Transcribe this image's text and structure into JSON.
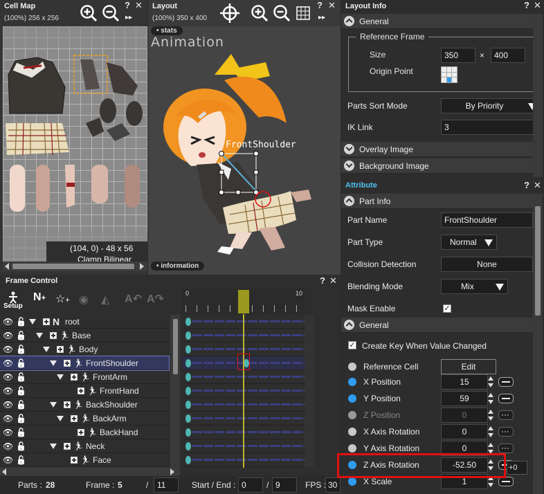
{
  "cell_map": {
    "title": "Cell Map",
    "zoom_info": "(100%) 256 x 256",
    "cell_info": "(104, 0) - 48 x 56",
    "filter_info": "Clamp  Bilinear"
  },
  "layout": {
    "title": "Layout",
    "zoom_info": "(100%) 350 x 400",
    "stats_tag": "stats",
    "animation_label": "Animation",
    "information_tag": "information",
    "part_label": "FrontShoulder"
  },
  "frame_control": {
    "title": "Frame Control",
    "setup_label": "Setup",
    "tree": [
      {
        "label": "root",
        "depth": 0,
        "kind": "root"
      },
      {
        "label": "Base",
        "depth": 1,
        "kind": "part"
      },
      {
        "label": "Body",
        "depth": 2,
        "kind": "part"
      },
      {
        "label": "FrontShoulder",
        "depth": 3,
        "kind": "part",
        "selected": true
      },
      {
        "label": "FrontArm",
        "depth": 4,
        "kind": "part"
      },
      {
        "label": "FrontHand",
        "depth": 5,
        "kind": "part"
      },
      {
        "label": "BackShoulder",
        "depth": 3,
        "kind": "part"
      },
      {
        "label": "BackArm",
        "depth": 4,
        "kind": "part"
      },
      {
        "label": "BackHand",
        "depth": 5,
        "kind": "part"
      },
      {
        "label": "Neck",
        "depth": 3,
        "kind": "part"
      },
      {
        "label": "Face",
        "depth": 4,
        "kind": "part"
      }
    ],
    "ruler_start": "0",
    "ruler_end": "10",
    "current_frame_index": 6,
    "parts_label": "Parts :",
    "parts_count": "28",
    "frame_label": "Frame :",
    "frame_value": "5",
    "frame_total": "11",
    "start_end_label": "Start / End :",
    "start_value": "0",
    "end_value": "9",
    "fps_label": "FPS :",
    "fps_value": "30"
  },
  "layout_info": {
    "title": "Layout Info",
    "general_label": "General",
    "reference_frame_label": "Reference Frame",
    "size_label": "Size",
    "size_w": "350",
    "size_x": "×",
    "size_h": "400",
    "origin_label": "Origin Point",
    "sort_mode_label": "Parts Sort Mode",
    "sort_mode_value": "By Priority",
    "ik_link_label": "IK Link",
    "ik_link_value": "3",
    "overlay_label": "Overlay Image",
    "background_label": "Background Image"
  },
  "attribute": {
    "title": "Attribute",
    "part_info_label": "Part Info",
    "part_name_label": "Part Name",
    "part_name_value": "FrontShoulder",
    "part_type_label": "Part Type",
    "part_type_value": "Normal",
    "collision_label": "Collision Detection",
    "collision_value": "None",
    "blending_label": "Blending Mode",
    "blending_value": "Mix",
    "mask_label": "Mask Enable",
    "general_label": "General",
    "create_key_label": "Create Key When Value Changed",
    "ref_cell_label": "Reference Cell",
    "edit_label": "Edit",
    "rows": [
      {
        "label": "X Position",
        "value": "15",
        "dot": "blue",
        "disabled": false
      },
      {
        "label": "Y Position",
        "value": "59",
        "dot": "blue",
        "disabled": false
      },
      {
        "label": "Z Position",
        "value": "0",
        "dot": "gray",
        "disabled": true
      },
      {
        "label": "X Axis Rotation",
        "value": "0",
        "dot": "lgray",
        "disabled": false
      },
      {
        "label": "Y Axis Rotation",
        "value": "0",
        "dot": "lgray",
        "disabled": false
      },
      {
        "label": "Z Axis Rotation",
        "value": "-52.50",
        "dot": "blue",
        "disabled": false
      },
      {
        "label": "X Scale",
        "value": "1",
        "dot": "blue",
        "disabled": false
      }
    ],
    "zrot_extra": "+0"
  },
  "colors": {
    "accent_blue": "#2f9cf0",
    "highlight_red": "#e01010",
    "keyframe_teal": "#4fb7b4",
    "current_frame_olive": "#9c9a1e"
  }
}
